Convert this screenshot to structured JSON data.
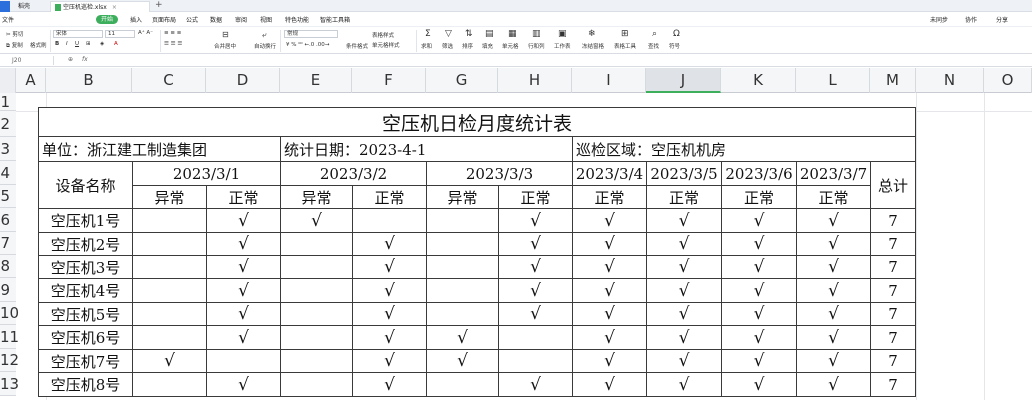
{
  "titlebar": {
    "app_tab": "",
    "home_tab": "稻壳",
    "file_tab": "空压机巡检.xlsx",
    "right_actions": [
      "未同步",
      "协作",
      "分享"
    ]
  },
  "menu": {
    "items": [
      "文件",
      "开始",
      "插入",
      "页面布局",
      "公式",
      "数据",
      "审阅",
      "视图",
      "特色功能",
      "智能工具箱"
    ]
  },
  "toolbar": {
    "cut": "剪切",
    "copy": "复制",
    "paste": "粘贴",
    "format_painter": "格式刷",
    "font_name": "宋体",
    "font_size": "11",
    "merge_center": "合并居中",
    "wrap": "自动换行",
    "number_format": "常规",
    "conditional_format": "条件格式",
    "table_style": "表格样式",
    "cell_style": "单元格样式",
    "sum": "求和",
    "filter": "筛选",
    "sort": "排序",
    "fill": "填充",
    "cell": "单元格",
    "row_col": "行和列",
    "worksheet": "工作表",
    "freeze": "冻结窗格",
    "table_tools": "表格工具",
    "find": "查找",
    "symbol": "符号"
  },
  "formula_bar": {
    "name_box": "J20",
    "fx": "fx",
    "value": ""
  },
  "columns": [
    "A",
    "B",
    "C",
    "D",
    "E",
    "F",
    "G",
    "H",
    "I",
    "J",
    "K",
    "L",
    "M",
    "N",
    "O"
  ],
  "rows": [
    "1",
    "2",
    "3",
    "4",
    "5",
    "6",
    "7",
    "8",
    "9",
    "10",
    "11",
    "12",
    "13"
  ],
  "sheet": {
    "title": "空压机日检月度统计表",
    "unit": "单位：浙江建工制造集团",
    "stat_date": "统计日期：2023-4-1",
    "area": "巡检区域：空压机机房",
    "device_header": "设备名称",
    "total_header": "总计",
    "dates": [
      "2023/3/1",
      "2023/3/2",
      "2023/3/3",
      "2023/3/4",
      "2023/3/5",
      "2023/3/6",
      "2023/3/7"
    ],
    "abnormal": "异常",
    "normal": "正常",
    "check": "√",
    "devices": [
      {
        "name": "空压机1号",
        "marks": [
          "",
          "√",
          "√",
          "",
          "",
          "√",
          "√",
          "√",
          "√",
          "√"
        ],
        "total": "7"
      },
      {
        "name": "空压机2号",
        "marks": [
          "",
          "√",
          "",
          "√",
          "",
          "√",
          "√",
          "√",
          "√",
          "√"
        ],
        "total": "7"
      },
      {
        "name": "空压机3号",
        "marks": [
          "",
          "√",
          "",
          "√",
          "",
          "√",
          "√",
          "√",
          "√",
          "√"
        ],
        "total": "7"
      },
      {
        "name": "空压机4号",
        "marks": [
          "",
          "√",
          "",
          "√",
          "",
          "√",
          "√",
          "√",
          "√",
          "√"
        ],
        "total": "7"
      },
      {
        "name": "空压机5号",
        "marks": [
          "",
          "√",
          "",
          "√",
          "",
          "√",
          "√",
          "√",
          "√",
          "√"
        ],
        "total": "7"
      },
      {
        "name": "空压机6号",
        "marks": [
          "",
          "√",
          "",
          "√",
          "√",
          "",
          "√",
          "√",
          "√",
          "√"
        ],
        "total": "7"
      },
      {
        "name": "空压机7号",
        "marks": [
          "√",
          "",
          "",
          "√",
          "√",
          "",
          "√",
          "√",
          "√",
          "√"
        ],
        "total": "7"
      },
      {
        "name": "空压机8号",
        "marks": [
          "",
          "√",
          "",
          "√",
          "",
          "√",
          "√",
          "√",
          "√",
          "√"
        ],
        "total": "7"
      }
    ]
  }
}
